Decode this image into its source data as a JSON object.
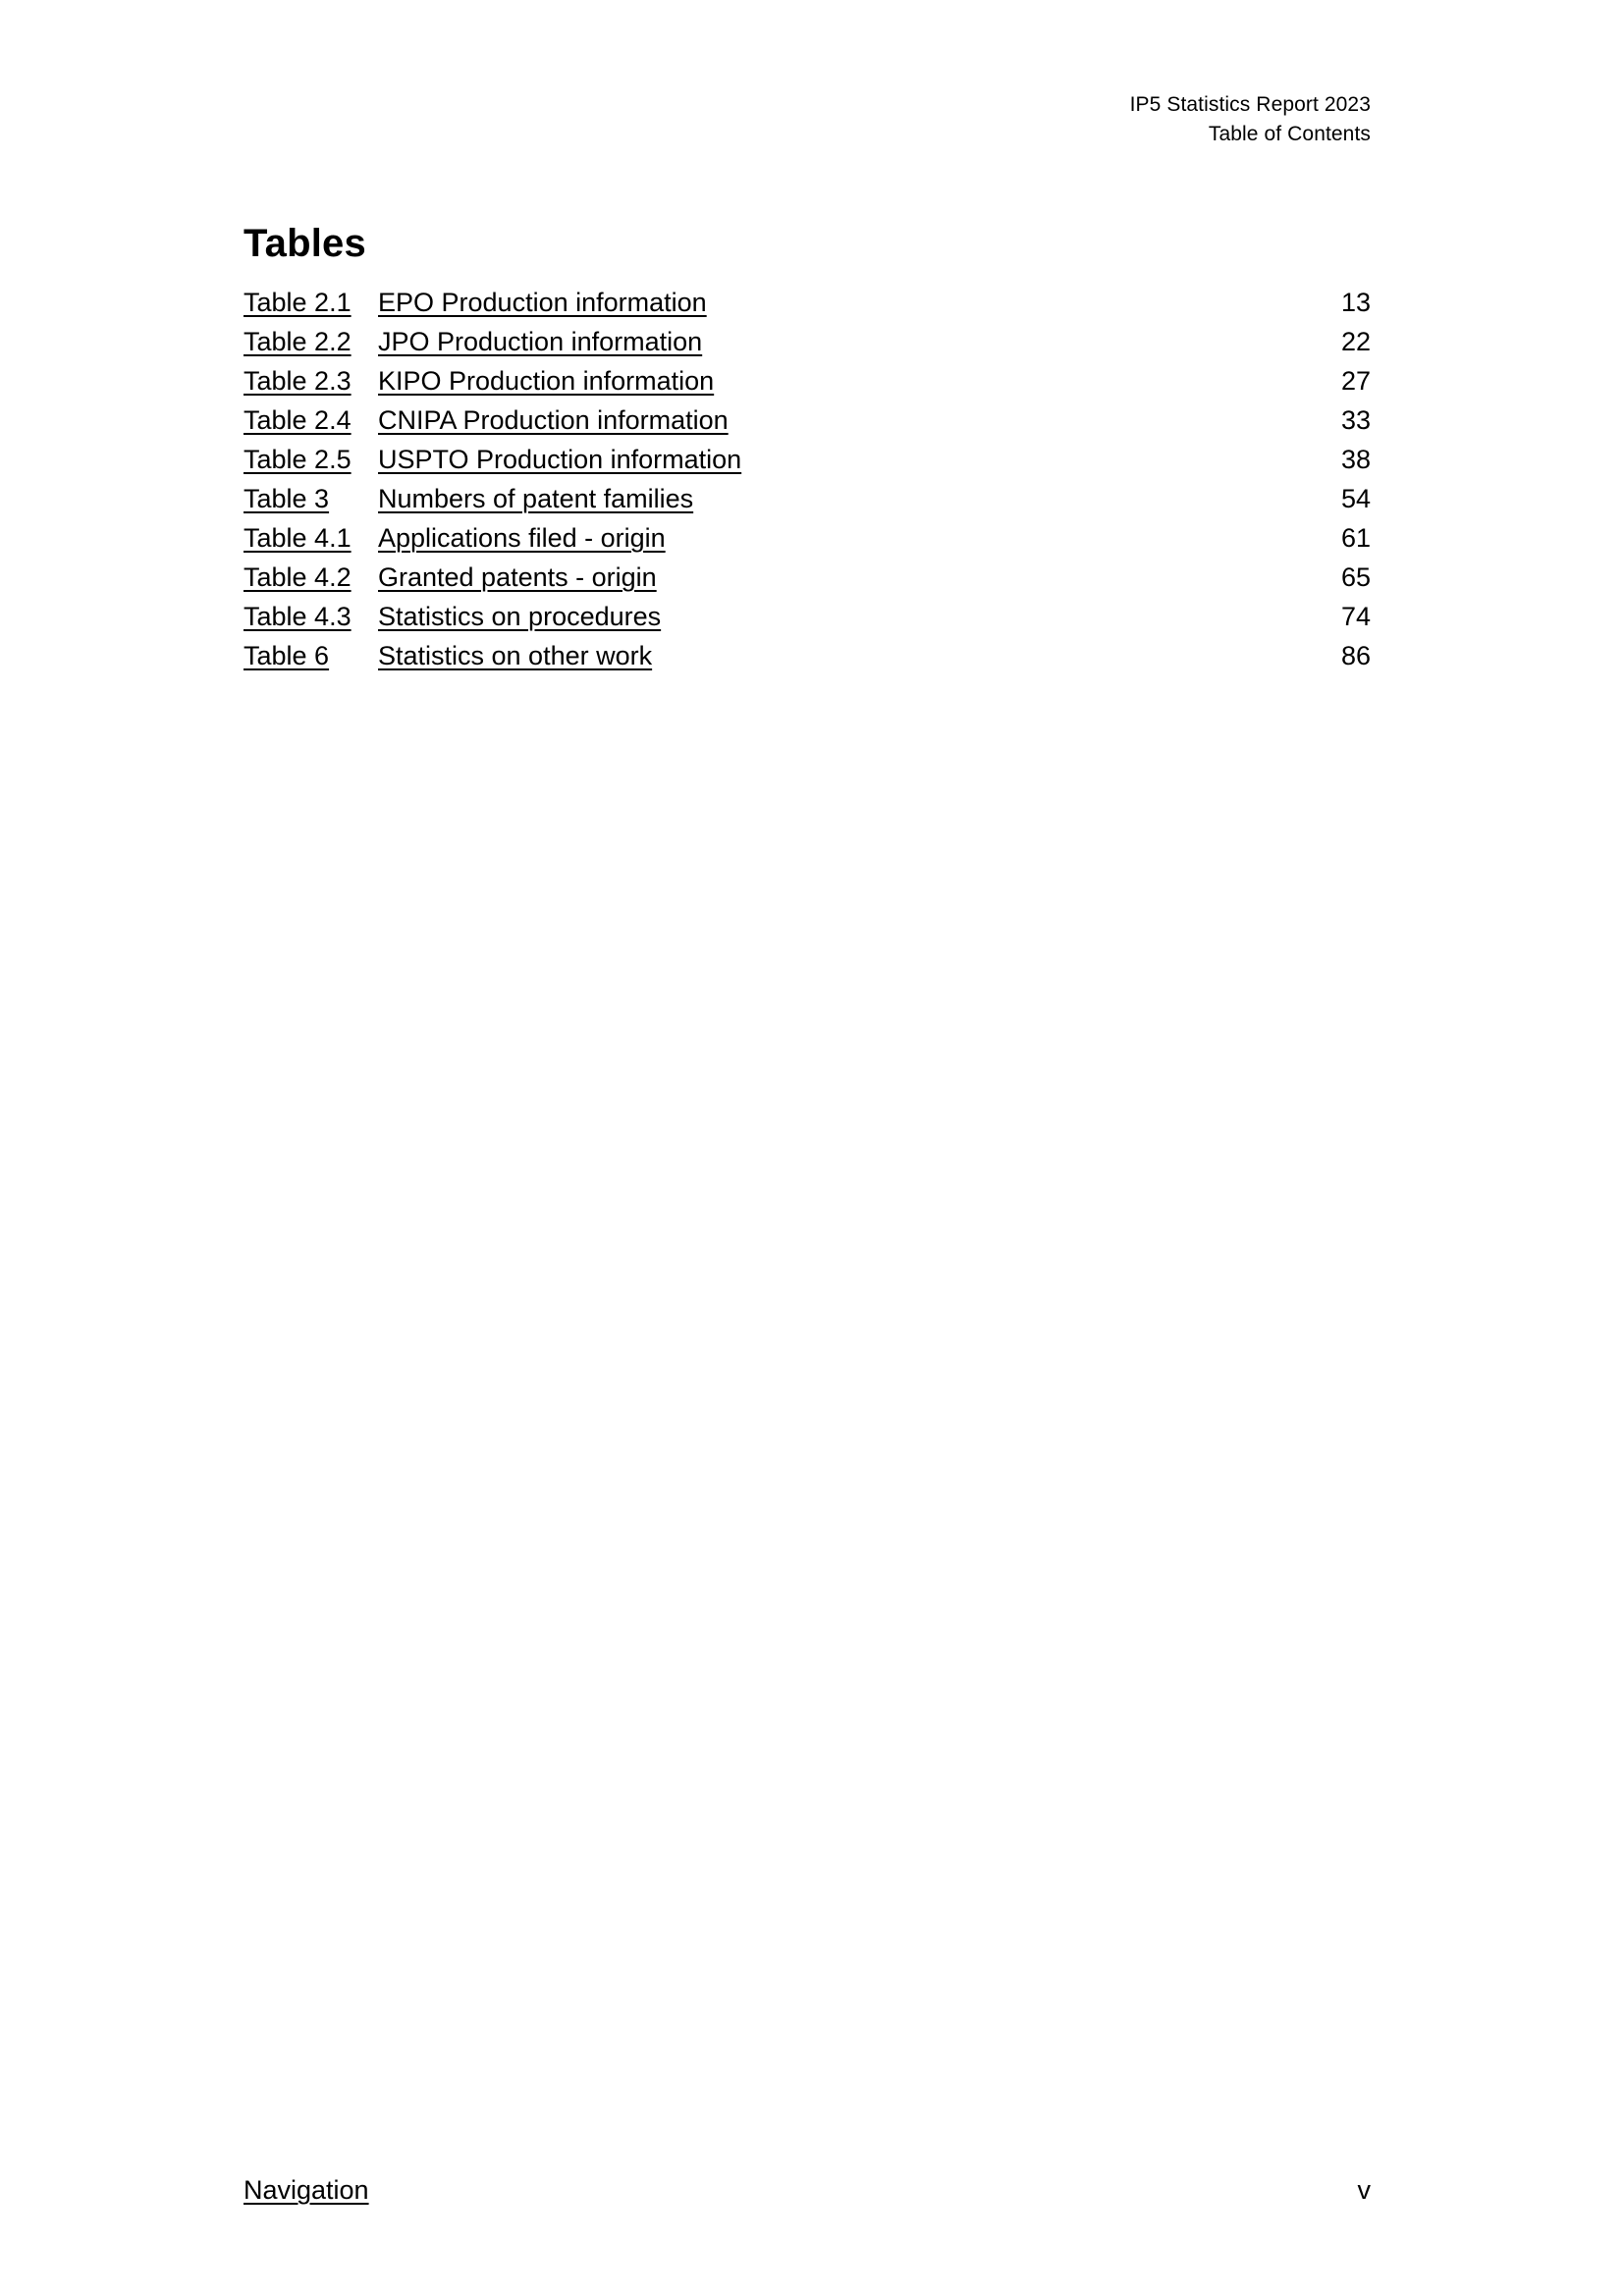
{
  "document": {
    "header": {
      "line1": "IP5 Statistics Report 2023",
      "line2": "Table of Contents"
    },
    "section_title": "Tables",
    "toc_entries": [
      {
        "label": "Table 2.1",
        "description": "EPO Production information",
        "page": "13"
      },
      {
        "label": "Table 2.2",
        "description": "JPO Production information",
        "page": "22"
      },
      {
        "label": "Table 2.3",
        "description": "KIPO Production information",
        "page": "27"
      },
      {
        "label": "Table 2.4",
        "description": "CNIPA Production information",
        "page": "33"
      },
      {
        "label": "Table 2.5",
        "description": "USPTO Production information",
        "page": "38"
      },
      {
        "label": "Table 3",
        "description": "Numbers of patent families",
        "page": "54"
      },
      {
        "label": "Table 4.1",
        "description": "Applications filed - origin",
        "page": "61"
      },
      {
        "label": "Table 4.2",
        "description": "Granted patents - origin",
        "page": "65"
      },
      {
        "label": "Table 4.3",
        "description": "Statistics on procedures",
        "page": "74"
      },
      {
        "label": "Table 6",
        "description": "Statistics on other work",
        "page": "86"
      }
    ],
    "footer": {
      "navigation_label": "Navigation",
      "page_number": "v"
    }
  }
}
